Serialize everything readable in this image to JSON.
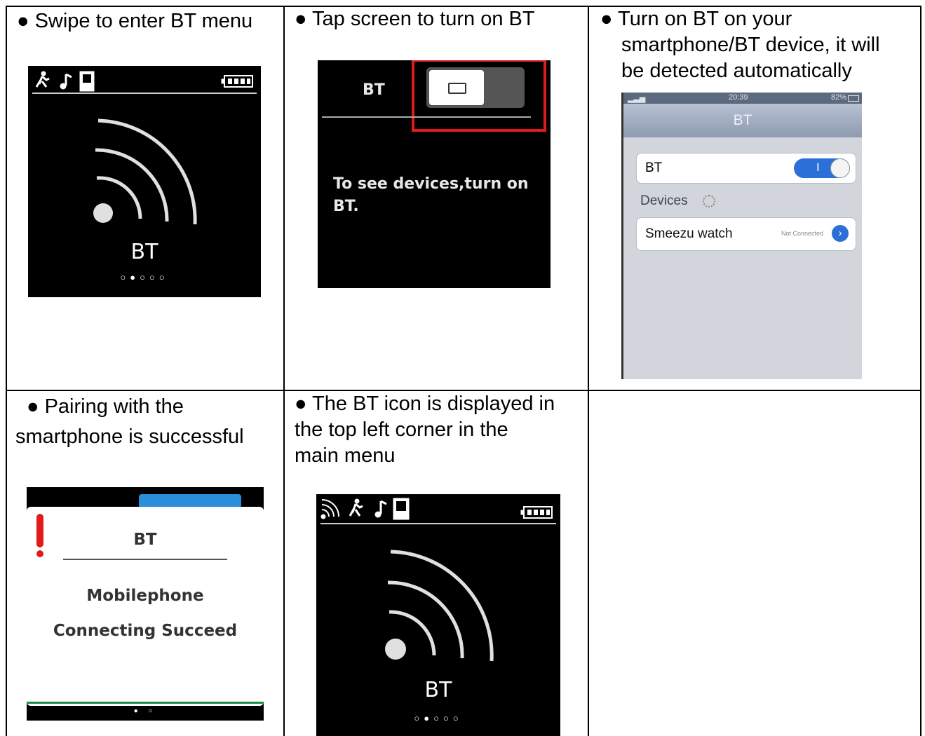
{
  "steps": [
    {
      "caption": "● Swipe to enter BT menu"
    },
    {
      "caption": "● Tap screen to turn on BT"
    },
    {
      "caption_lines": [
        "● Turn on BT on your",
        "smartphone/BT device, it will",
        "be detected automatically"
      ]
    },
    {
      "caption_lines": [
        "● Pairing with the",
        "smartphone is successful"
      ]
    },
    {
      "caption_lines": [
        "● The BT icon is displayed in",
        "the top left corner in the",
        "main menu"
      ]
    }
  ],
  "watch_menu": {
    "label": "BT",
    "dots": "○●○○○",
    "icons": [
      "runner-icon",
      "music-note-icon",
      "phone-icon",
      "battery-icon"
    ]
  },
  "bt_toggle_screen": {
    "title": "BT",
    "message_lines": [
      "To see devices,turn on",
      "BT."
    ],
    "highlight_color": "#e01b1b"
  },
  "phone_settings": {
    "status_time": "20:39",
    "status_battery": "82%",
    "nav_title": "BT",
    "bt_row_label": "BT",
    "toggle_text": "I",
    "devices_header": "Devices",
    "device_name": "Smeezu watch",
    "device_status": "Not Connected",
    "accent_color": "#2c6fd6"
  },
  "pairing_popup": {
    "title": "BT",
    "line1": "Mobilephone",
    "line2": "Connecting Succeed",
    "dots": "● ○"
  },
  "main_menu": {
    "label": "BT",
    "dots": "○●○○○",
    "icons": [
      "bt-signal-icon",
      "runner-icon",
      "music-note-icon",
      "phone-icon",
      "battery-icon"
    ]
  }
}
